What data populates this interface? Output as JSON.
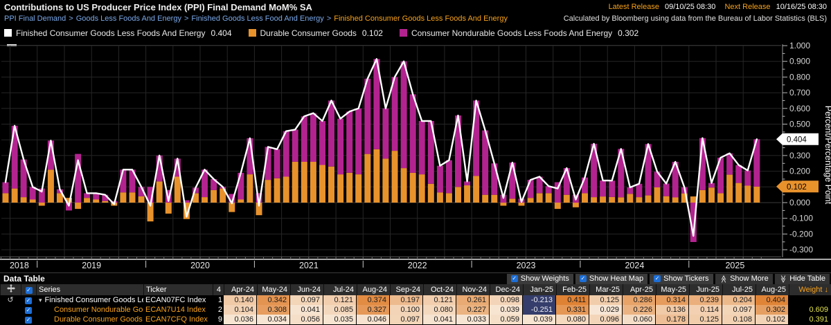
{
  "header": {
    "title": "Contributions to US Producer Price Index (PPI) Final Demand MoM% SA",
    "breadcrumb": [
      "PPI Final Demand",
      "Goods Less Foods And Energy",
      "Finished Goods Less Food And Energy",
      "Finished Consumer Goods Less Foods And Energy"
    ],
    "breadcrumb_separator": ">",
    "latest_release_label": "Latest Release",
    "latest_release_value": "09/10/25 08:30",
    "next_release_label": "Next Release",
    "next_release_value": "10/16/25 08:30",
    "source_note": "Calculated by Bloomberg using data from the Bureau of Labor Statistics (BLS)"
  },
  "legend": [
    {
      "label": "Finished Consumer Goods Less Foods And Energy",
      "value": "0.404",
      "color": "#ffffff"
    },
    {
      "label": "Durable Consumer Goods",
      "value": "0.102",
      "color": "#e8922c"
    },
    {
      "label": "Consumer Nondurable Goods Less Foods And Energy",
      "value": "0.302",
      "color": "#b32390"
    }
  ],
  "chart_data": {
    "type": "bar",
    "subtype": "stacked-bars-with-total-line",
    "start_month": "2018-09",
    "end_month": "2025-08",
    "ylim": [
      -0.3,
      1.0
    ],
    "grid": true,
    "year_labels": [
      "2018",
      "2019",
      "2020",
      "2021",
      "2022",
      "2023",
      "2024",
      "2025"
    ],
    "y_axis": {
      "title": "Percent/Percentage Point",
      "ticks": [
        {
          "v": 1.0,
          "label": "1.000"
        },
        {
          "v": 0.9,
          "label": "0.900"
        },
        {
          "v": 0.8,
          "label": "0.800"
        },
        {
          "v": 0.7,
          "label": "0.700"
        },
        {
          "v": 0.6,
          "label": "0.600"
        },
        {
          "v": 0.5,
          "label": "0.500"
        },
        {
          "v": 0.4,
          "label": ""
        },
        {
          "v": 0.3,
          "label": "0.300"
        },
        {
          "v": 0.2,
          "label": "0.200"
        },
        {
          "v": 0.1,
          "label": ""
        },
        {
          "v": 0.0,
          "label": "0.000"
        },
        {
          "v": -0.1,
          "label": "-0.100"
        },
        {
          "v": -0.2,
          "label": "-0.200"
        },
        {
          "v": -0.3,
          "label": "-0.300"
        }
      ]
    },
    "badges": [
      {
        "value": "0.404",
        "v": 0.404,
        "fill": "#ffffff",
        "text": "#000000"
      },
      {
        "value": "0.102",
        "v": 0.102,
        "fill": "#e8922c",
        "text": "#000000"
      }
    ],
    "series": [
      {
        "name": "Durable Consumer Goods",
        "kind": "bar",
        "color": "#e8922c",
        "values": [
          0.06,
          0.09,
          0.035,
          0.02,
          -0.02,
          0.21,
          0.06,
          0.03,
          -0.04,
          0.03,
          0.02,
          0.01,
          -0.02,
          0.065,
          0.065,
          0.04,
          -0.12,
          0.135,
          -0.07,
          0.165,
          -0.105,
          0.06,
          0.035,
          0.08,
          0.09,
          -0.06,
          0.02,
          0.18,
          -0.08,
          0.145,
          0.155,
          0.165,
          0.26,
          0.26,
          0.26,
          0.24,
          0.23,
          0.18,
          0.19,
          0.18,
          0.31,
          0.34,
          0.28,
          0.33,
          0.22,
          0.19,
          0.18,
          0.12,
          0.065,
          0.06,
          0.1,
          0.11,
          0.17,
          0.05,
          0.05,
          -0.02,
          0.025,
          -0.02,
          0.03,
          0.06,
          0.06,
          -0.04,
          0.05,
          -0.03,
          0.06,
          0.035,
          0.039,
          0.036,
          0.034,
          0.056,
          0.035,
          0.046,
          0.097,
          0.041,
          0.033,
          0.059,
          0.039,
          0.08,
          0.096,
          0.06,
          0.178,
          0.125,
          0.108,
          0.102
        ]
      },
      {
        "name": "Consumer Nondurable Goods Less Foods And Energy",
        "kind": "bar",
        "color": "#b32390",
        "values": [
          0.07,
          0.4,
          0.24,
          0.08,
          0.09,
          0.185,
          0.025,
          -0.05,
          0.31,
          0.03,
          0.04,
          0.04,
          0.01,
          0.145,
          0.145,
          0.06,
          0.1,
          0.165,
          0.08,
          0.115,
          0.015,
          0.035,
          0.175,
          0.07,
          0.01,
          0.055,
          0.17,
          0.23,
          0.06,
          0.21,
          0.185,
          0.29,
          0.205,
          0.29,
          0.31,
          0.28,
          0.42,
          0.355,
          0.39,
          0.42,
          0.48,
          0.575,
          0.32,
          0.47,
          0.68,
          0.5,
          0.34,
          0.4,
          0.17,
          0.21,
          0.455,
          0.025,
          0.48,
          0.41,
          0.2,
          0.05,
          0.23,
          0.025,
          0.115,
          0.105,
          0.045,
          0.13,
          0.17,
          0.05,
          0.1,
          0.34,
          0.102,
          0.104,
          0.308,
          0.041,
          0.085,
          0.327,
          0.1,
          0.08,
          0.227,
          0.039,
          -0.251,
          0.331,
          0.029,
          0.226,
          0.136,
          0.114,
          0.097,
          0.302
        ]
      },
      {
        "name": "Finished Consumer Goods Less Foods And Energy",
        "kind": "line",
        "color": "#ffffff",
        "role": "sum-of-bars"
      }
    ]
  },
  "table": {
    "title": "Data Table",
    "controls": [
      {
        "type": "checkbox",
        "checked": true,
        "label": "Show Weights"
      },
      {
        "type": "checkbox",
        "checked": true,
        "label": "Show Heat Map"
      },
      {
        "type": "checkbox",
        "checked": true,
        "label": "Show Tickers"
      },
      {
        "type": "button",
        "icon": "chevrons-up",
        "label": "Show More"
      },
      {
        "type": "button",
        "icon": "chevrons-down",
        "label": "Hide Table"
      }
    ],
    "series_header": "Series",
    "ticker_header": "Ticker",
    "partial_column_header": "4",
    "month_columns": [
      "Apr-24",
      "May-24",
      "Jun-24",
      "Jul-24",
      "Aug-24",
      "Sep-24",
      "Oct-24",
      "Nov-24",
      "Dec-24",
      "Jan-25",
      "Feb-25",
      "Mar-25",
      "Apr-25",
      "May-25",
      "Jun-25",
      "Jul-25",
      "Aug-25"
    ],
    "weight_header": "Weight",
    "sort_arrow": "↓",
    "rows": [
      {
        "icon": "drill-up",
        "expander": "▾",
        "series": "Finished Consumer Goods Less...",
        "ticker": "ECAN07FC Index",
        "partial": "1",
        "text_color": "white",
        "values": [
          0.14,
          0.342,
          0.097,
          0.121,
          0.374,
          0.197,
          0.121,
          0.261,
          0.098,
          -0.213,
          0.411,
          0.125,
          0.286,
          0.314,
          0.239,
          0.204,
          0.404
        ],
        "weight": ""
      },
      {
        "icon": "",
        "expander": "",
        "series": "Consumer Nondurable Goods ...",
        "ticker": "ECAN7U14 Index",
        "partial": "2",
        "text_color": "orange",
        "indent": true,
        "values": [
          0.104,
          0.308,
          0.041,
          0.085,
          0.327,
          0.1,
          0.08,
          0.227,
          0.039,
          -0.251,
          0.331,
          0.029,
          0.226,
          0.136,
          0.114,
          0.097,
          0.302
        ],
        "weight": "0.609"
      },
      {
        "icon": "",
        "expander": "",
        "series": "Durable Consumer Goods",
        "ticker": "ECAN7CFQ Index",
        "partial": "9",
        "text_color": "orange",
        "indent": true,
        "values": [
          0.036,
          0.034,
          0.056,
          0.035,
          0.046,
          0.097,
          0.041,
          0.033,
          0.059,
          0.039,
          0.08,
          0.096,
          0.06,
          0.178,
          0.125,
          0.108,
          0.102
        ],
        "weight": "0.391"
      }
    ],
    "heat": {
      "positive_low": "#f9eee1",
      "positive_high": "#df8030",
      "positive_max": 0.42,
      "negative_bg": "#343d6b",
      "negative_fg": "#f0f0f5"
    }
  }
}
